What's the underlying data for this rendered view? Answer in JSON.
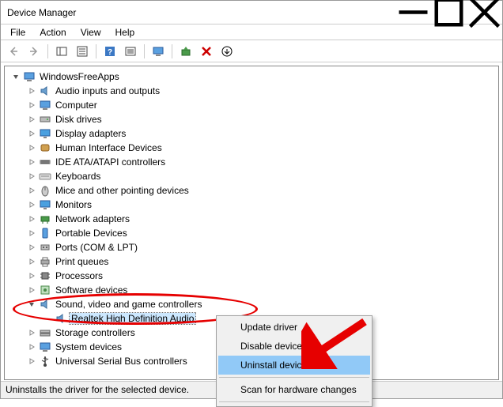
{
  "window": {
    "title": "Device Manager"
  },
  "menu": {
    "file": "File",
    "action": "Action",
    "view": "View",
    "help": "Help"
  },
  "tree": {
    "root": "WindowsFreeApps",
    "items": [
      "Audio inputs and outputs",
      "Computer",
      "Disk drives",
      "Display adapters",
      "Human Interface Devices",
      "IDE ATA/ATAPI controllers",
      "Keyboards",
      "Mice and other pointing devices",
      "Monitors",
      "Network adapters",
      "Portable Devices",
      "Ports (COM & LPT)",
      "Print queues",
      "Processors",
      "Software devices",
      "Sound, video and game controllers",
      "Storage controllers",
      "System devices",
      "Universal Serial Bus controllers"
    ],
    "sound_child": "Realtek High Definition Audio"
  },
  "context_menu": {
    "update": "Update driver",
    "disable": "Disable device",
    "uninstall": "Uninstall device",
    "scan": "Scan for hardware changes"
  },
  "status": "Uninstalls the driver for the selected device."
}
